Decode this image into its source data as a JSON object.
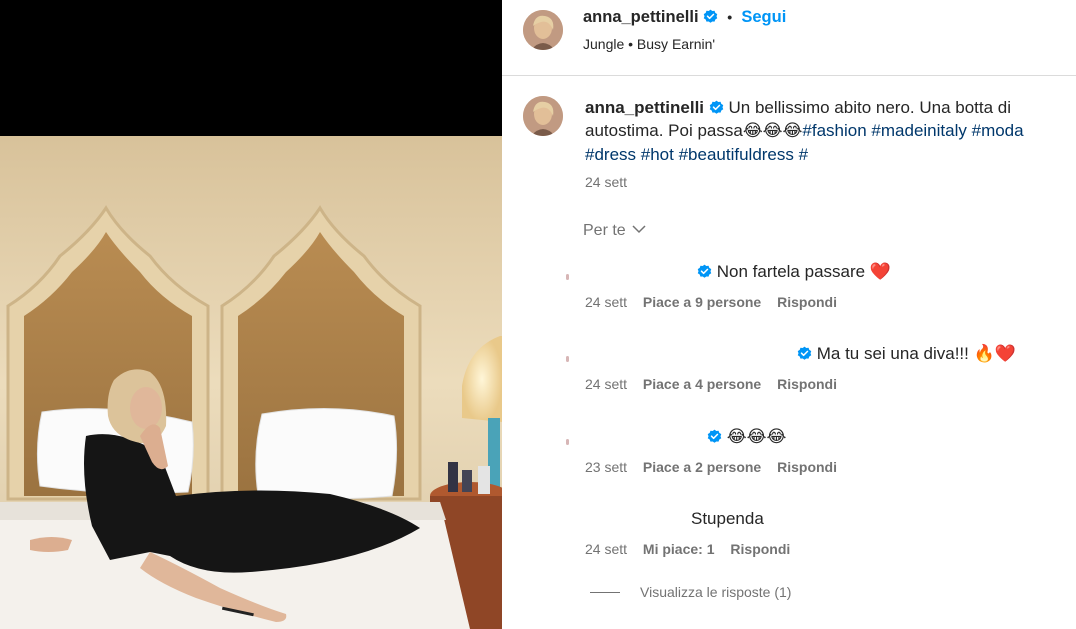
{
  "post": {
    "username": "anna_pettinelli",
    "separator": "•",
    "follow_label": "Segui",
    "audio": "Jungle • Busy Earnin'",
    "caption_text": "Un bellissimo abito nero. Una botta di autostima. Poi passa",
    "caption_emojis": "😂😂😂",
    "hashtags": [
      "#fashion",
      "#madeinitaly",
      "#moda",
      "#dress",
      "#hot",
      "#beautifuldress",
      "#"
    ],
    "date": "24 sett"
  },
  "sort": {
    "label": "Per te"
  },
  "comments": [
    {
      "text": "Non fartela passare",
      "emoji": "❤️",
      "date": "24 sett",
      "likes": "Piace a 9 persone",
      "reply": "Rispondi"
    },
    {
      "text": "Ma tu sei una diva!!!",
      "emoji": "🔥❤️",
      "date": "24 sett",
      "likes": "Piace a 4 persone",
      "reply": "Rispondi"
    },
    {
      "text": "",
      "emoji": "😂😂😂",
      "date": "23 sett",
      "likes": "Piace a 2 persone",
      "reply": "Rispondi"
    },
    {
      "text": "Stupenda",
      "emoji": "",
      "date": "24 sett",
      "likes": "Mi piace: 1",
      "reply": "Rispondi"
    }
  ],
  "view_replies": "Visualizza le risposte (1)",
  "colors": {
    "accent": "#0095f6",
    "hashtag": "#00376b",
    "verified": "#0095f6",
    "muted": "#737373"
  },
  "icons": [
    "verified-badge-icon",
    "chevron-down-icon",
    "heart-emoji",
    "fire-emoji",
    "laughing-emoji"
  ]
}
